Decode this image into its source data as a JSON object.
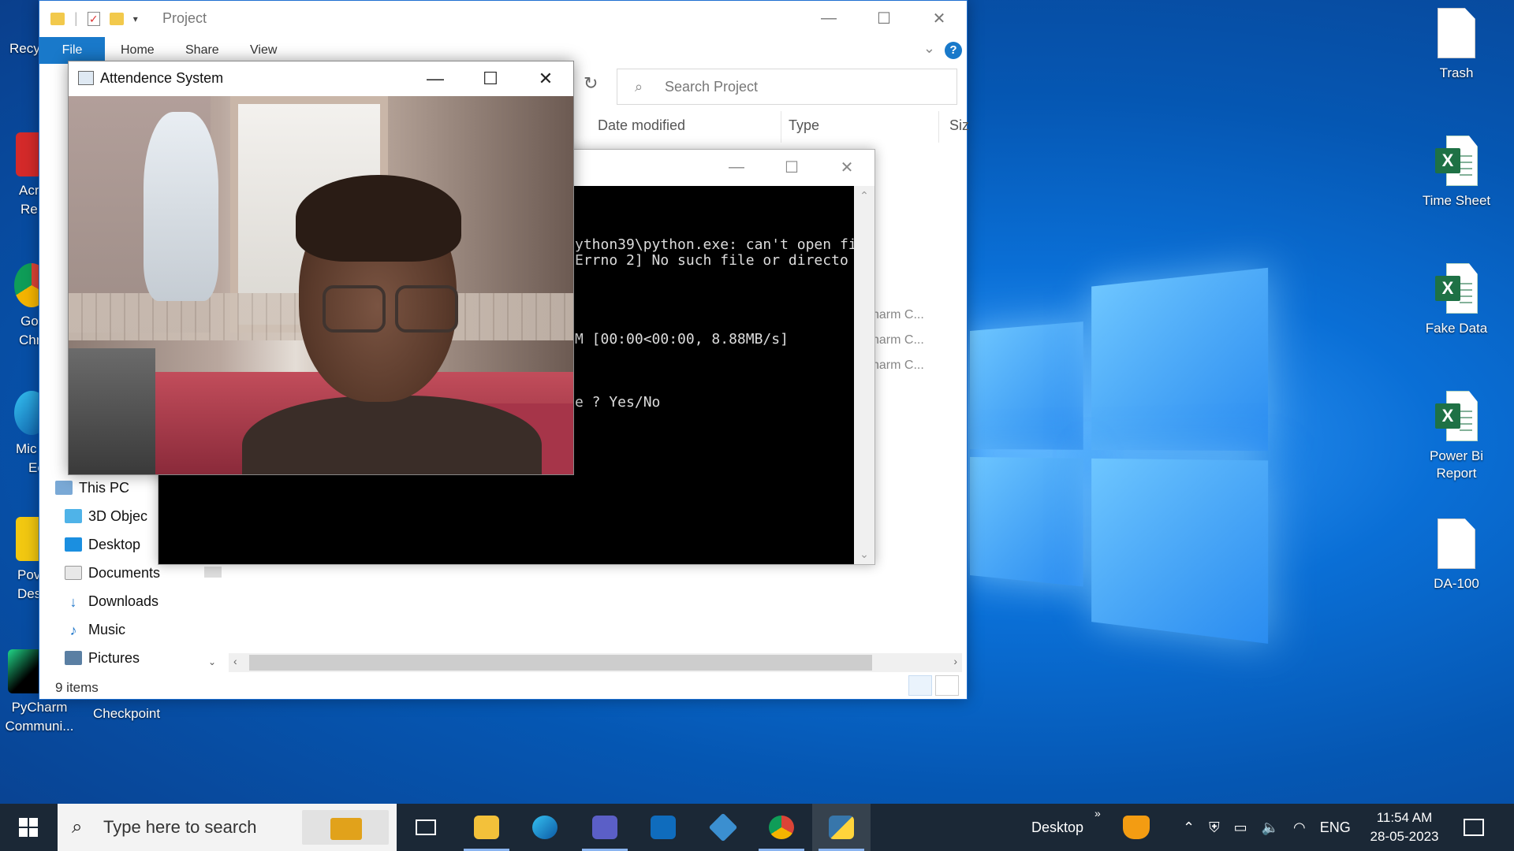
{
  "desktop": {
    "icons_right": [
      {
        "label": "Trash",
        "icon": "document-icon",
        "kind": "doc"
      },
      {
        "label": "Time Sheet",
        "icon": "excel-file-icon",
        "kind": "xls"
      },
      {
        "label": "Fake Data",
        "icon": "excel-file-icon",
        "kind": "xls"
      },
      {
        "label": "Power Bi Report",
        "icon": "excel-file-icon",
        "kind": "xls"
      },
      {
        "label": "DA-100",
        "icon": "document-icon",
        "kind": "doc"
      }
    ],
    "icons_left_partial": [
      "Recy",
      "Acr",
      "Re",
      "Go",
      "Chr",
      "Mic",
      "Ec",
      "Pov",
      "Des"
    ],
    "pycharm_label": "PyCharm Communi...",
    "checkpoint_label": "Checkpoint"
  },
  "explorer": {
    "title": "Project",
    "ribbon": {
      "file": "File",
      "home": "Home",
      "share": "Share",
      "view": "View"
    },
    "search_placeholder": "Search Project",
    "columns": {
      "date": "Date modified",
      "type": "Type",
      "size": "Siz"
    },
    "file_type_fragments": [
      "harm C...",
      "harm C...",
      "harm C..."
    ],
    "nav": [
      {
        "label": "This PC",
        "icon": "computer-icon"
      },
      {
        "label": "3D Objec",
        "icon": "3d-objects-icon"
      },
      {
        "label": "Desktop",
        "icon": "desktop-folder-icon"
      },
      {
        "label": "Documents",
        "icon": "documents-icon"
      },
      {
        "label": "Downloads",
        "icon": "downloads-icon"
      },
      {
        "label": "Music",
        "icon": "music-icon"
      },
      {
        "label": "Pictures",
        "icon": "pictures-icon"
      }
    ],
    "status": "9 items"
  },
  "console": {
    "lines": [
      "ython39\\python.exe: can't open fi",
      "Errno 2] No such file or directo",
      "M [00:00<00:00, 8.88MB/s]",
      "e ? Yes/No"
    ]
  },
  "camera_window": {
    "title": "Attendence System"
  },
  "taskbar": {
    "search_placeholder": "Type here to search",
    "desktop_label": "Desktop",
    "language": "ENG",
    "time": "11:54 AM",
    "date": "28-05-2023",
    "apps": [
      "task-view-icon",
      "file-explorer-icon",
      "edge-icon",
      "teams-icon",
      "outlook-icon",
      "git-icon",
      "chrome-icon",
      "python-icon"
    ]
  },
  "colors": {
    "accent": "#1979ca",
    "taskbar": "#1b2836",
    "desktop": "#0a6fd6"
  }
}
